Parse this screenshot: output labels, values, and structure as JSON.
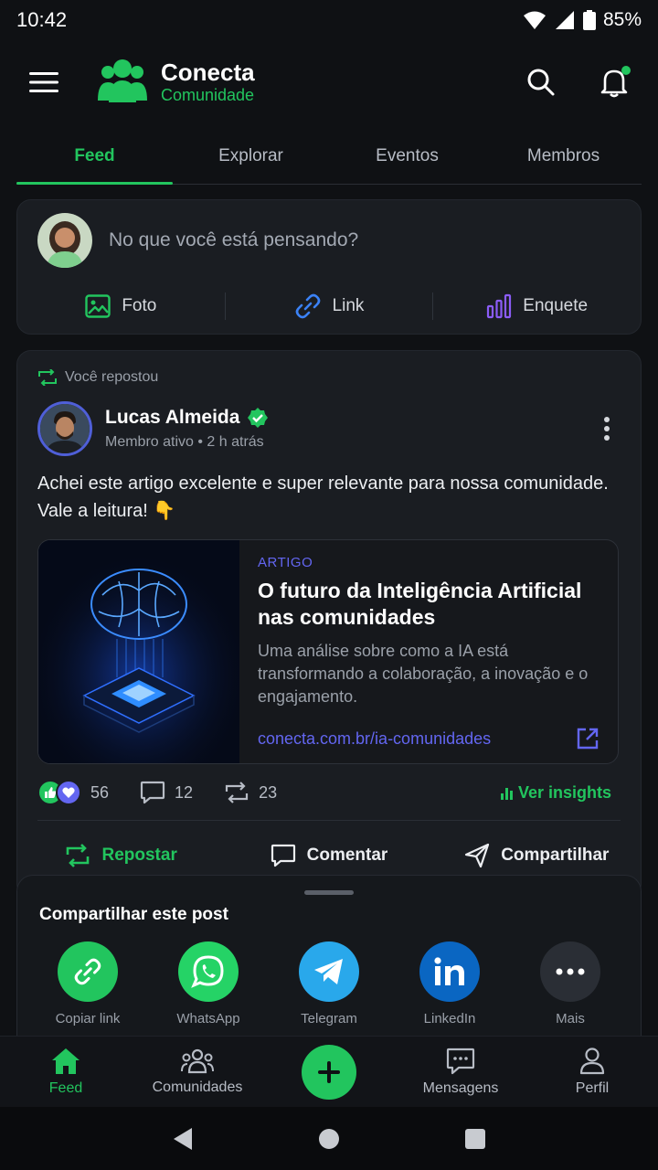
{
  "status_bar": {
    "time": "10:42",
    "battery": "85%"
  },
  "header": {
    "app_name": "Conecta",
    "app_subtitle": "Comunidade"
  },
  "tabs": [
    {
      "label": "Feed",
      "active": true
    },
    {
      "label": "Explorar",
      "active": false
    },
    {
      "label": "Eventos",
      "active": false
    },
    {
      "label": "Membros",
      "active": false
    }
  ],
  "composer": {
    "placeholder": "No que você está pensando?",
    "actions": {
      "photo": "Foto",
      "link": "Link",
      "poll": "Enquete"
    }
  },
  "post": {
    "repost_note": "Você repostou",
    "author_name": "Lucas Almeida",
    "author_meta": "Membro ativo • 2 h atrás",
    "text": "Achei este artigo excelente e super relevante para nossa comunidade. Vale a leitura! 👇",
    "link_card": {
      "tag": "ARTIGO",
      "title": "O futuro da Inteligência Artificial nas comunidades",
      "description": "Uma análise sobre como a IA está transformando a colaboração, a inovação e o engajamento.",
      "url": "conecta.com.br/ia-comunidades"
    },
    "stats": {
      "reactions": "56",
      "comments": "12",
      "reposts": "23",
      "insights": "Ver insights"
    },
    "actions": {
      "repost": "Repostar",
      "comment": "Comentar",
      "share": "Compartilhar"
    }
  },
  "share_sheet": {
    "title": "Compartilhar este post",
    "options": {
      "copy_link": "Copiar link",
      "whatsapp": "WhatsApp",
      "telegram": "Telegram",
      "linkedin": "LinkedIn",
      "more": "Mais"
    }
  },
  "bottom_nav": {
    "feed": "Feed",
    "communities": "Comunidades",
    "messages": "Mensagens",
    "profile": "Perfil"
  },
  "colors": {
    "accent": "#22c55e",
    "link": "#6366f1",
    "background": "#0f1114",
    "card": "#1a1d22"
  }
}
